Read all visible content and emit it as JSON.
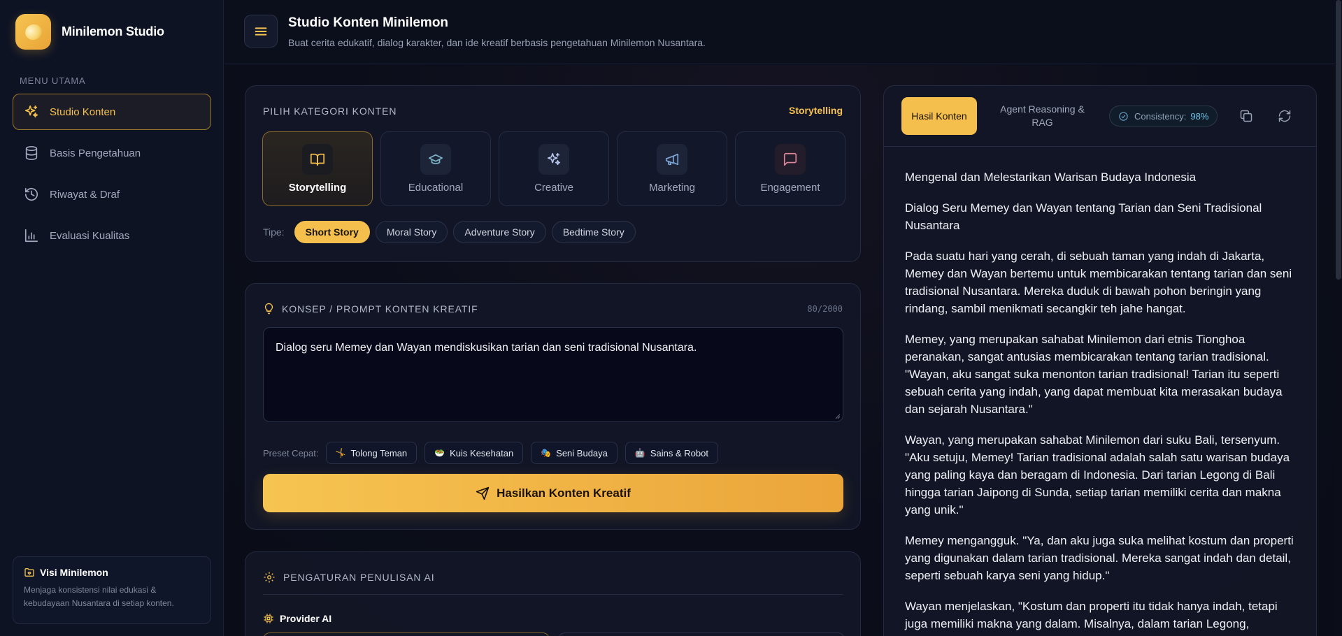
{
  "sidebar": {
    "brand": "Minilemon Studio",
    "menu_title": "MENU UTAMA",
    "items": [
      {
        "label": "Studio Konten",
        "icon": "sparkles-icon"
      },
      {
        "label": "Basis Pengetahuan",
        "icon": "database-icon"
      },
      {
        "label": "Riwayat & Draf",
        "icon": "history-icon"
      },
      {
        "label": "Evaluasi Kualitas",
        "icon": "bar-chart-icon"
      }
    ],
    "visi": {
      "title": "Visi Minilemon",
      "desc": "Menjaga konsistensi nilai edukasi & kebudayaan Nusantara di setiap konten."
    }
  },
  "header": {
    "title": "Studio Konten Minilemon",
    "subtitle": "Buat cerita edukatif, dialog karakter, dan ide kreatif berbasis pengetahuan Minilemon Nusantara."
  },
  "kategori": {
    "label": "PILIH KATEGORI KONTEN",
    "current": "Storytelling",
    "tiles": [
      {
        "label": "Storytelling",
        "icon": "book-open-icon"
      },
      {
        "label": "Educational",
        "icon": "graduation-cap-icon"
      },
      {
        "label": "Creative",
        "icon": "sparkles-icon"
      },
      {
        "label": "Marketing",
        "icon": "megaphone-icon"
      },
      {
        "label": "Engagement",
        "icon": "message-square-icon"
      }
    ],
    "tipe_label": "Tipe:",
    "tipe": [
      "Short Story",
      "Moral Story",
      "Adventure Story",
      "Bedtime Story"
    ]
  },
  "prompt": {
    "label": "KONSEP / PROMPT KONTEN KREATIF",
    "count": "80/2000",
    "value": "Dialog seru Memey dan Wayan mendiskusikan tarian dan seni tradisional Nusantara.",
    "preset_label": "Preset Cepat:",
    "presets": [
      {
        "emoji": "🤸",
        "label": "Tolong Teman"
      },
      {
        "emoji": "🥗",
        "label": "Kuis Kesehatan"
      },
      {
        "emoji": "🎭",
        "label": "Seni Budaya"
      },
      {
        "emoji": "🤖",
        "label": "Sains & Robot"
      }
    ],
    "button": "Hasilkan Konten Kreatif"
  },
  "pengaturan": {
    "label": "PENGATURAN PENULISAN AI",
    "provider": "Provider AI"
  },
  "result": {
    "tab_hasil": "Hasil Konten",
    "tab_agent": "Agent Reasoning & RAG",
    "consistency_label": "Consistency:",
    "consistency_value": "98%",
    "paragraphs": [
      "Mengenal dan Melestarikan Warisan Budaya Indonesia",
      "Dialog Seru Memey dan Wayan tentang Tarian dan Seni Tradisional Nusantara",
      "Pada suatu hari yang cerah, di sebuah taman yang indah di Jakarta, Memey dan Wayan bertemu untuk membicarakan tentang tarian dan seni tradisional Nusantara. Mereka duduk di bawah pohon beringin yang rindang, sambil menikmati secangkir teh jahe hangat.",
      "Memey, yang merupakan sahabat Minilemon dari etnis Tionghoa peranakan, sangat antusias membicarakan tentang tarian tradisional. \"Wayan, aku sangat suka menonton tarian tradisional! Tarian itu seperti sebuah cerita yang indah, yang dapat membuat kita merasakan budaya dan sejarah Nusantara.\"",
      "Wayan, yang merupakan sahabat Minilemon dari suku Bali, tersenyum. \"Aku setuju, Memey! Tarian tradisional adalah salah satu warisan budaya yang paling kaya dan beragam di Indonesia. Dari tarian Legong di Bali hingga tarian Jaipong di Sunda, setiap tarian memiliki cerita dan makna yang unik.\"",
      "Memey mengangguk. \"Ya, dan aku juga suka melihat kostum dan properti yang digunakan dalam tarian tradisional. Mereka sangat indah dan detail, seperti sebuah karya seni yang hidup.\"",
      "Wayan menjelaskan, \"Kostum dan properti itu tidak hanya indah, tetapi juga memiliki makna yang dalam. Misalnya, dalam tarian Legong,"
    ]
  },
  "colors": {
    "accent": "#f4bf4d",
    "background": "#0a0d1a",
    "panel": "#121626"
  }
}
